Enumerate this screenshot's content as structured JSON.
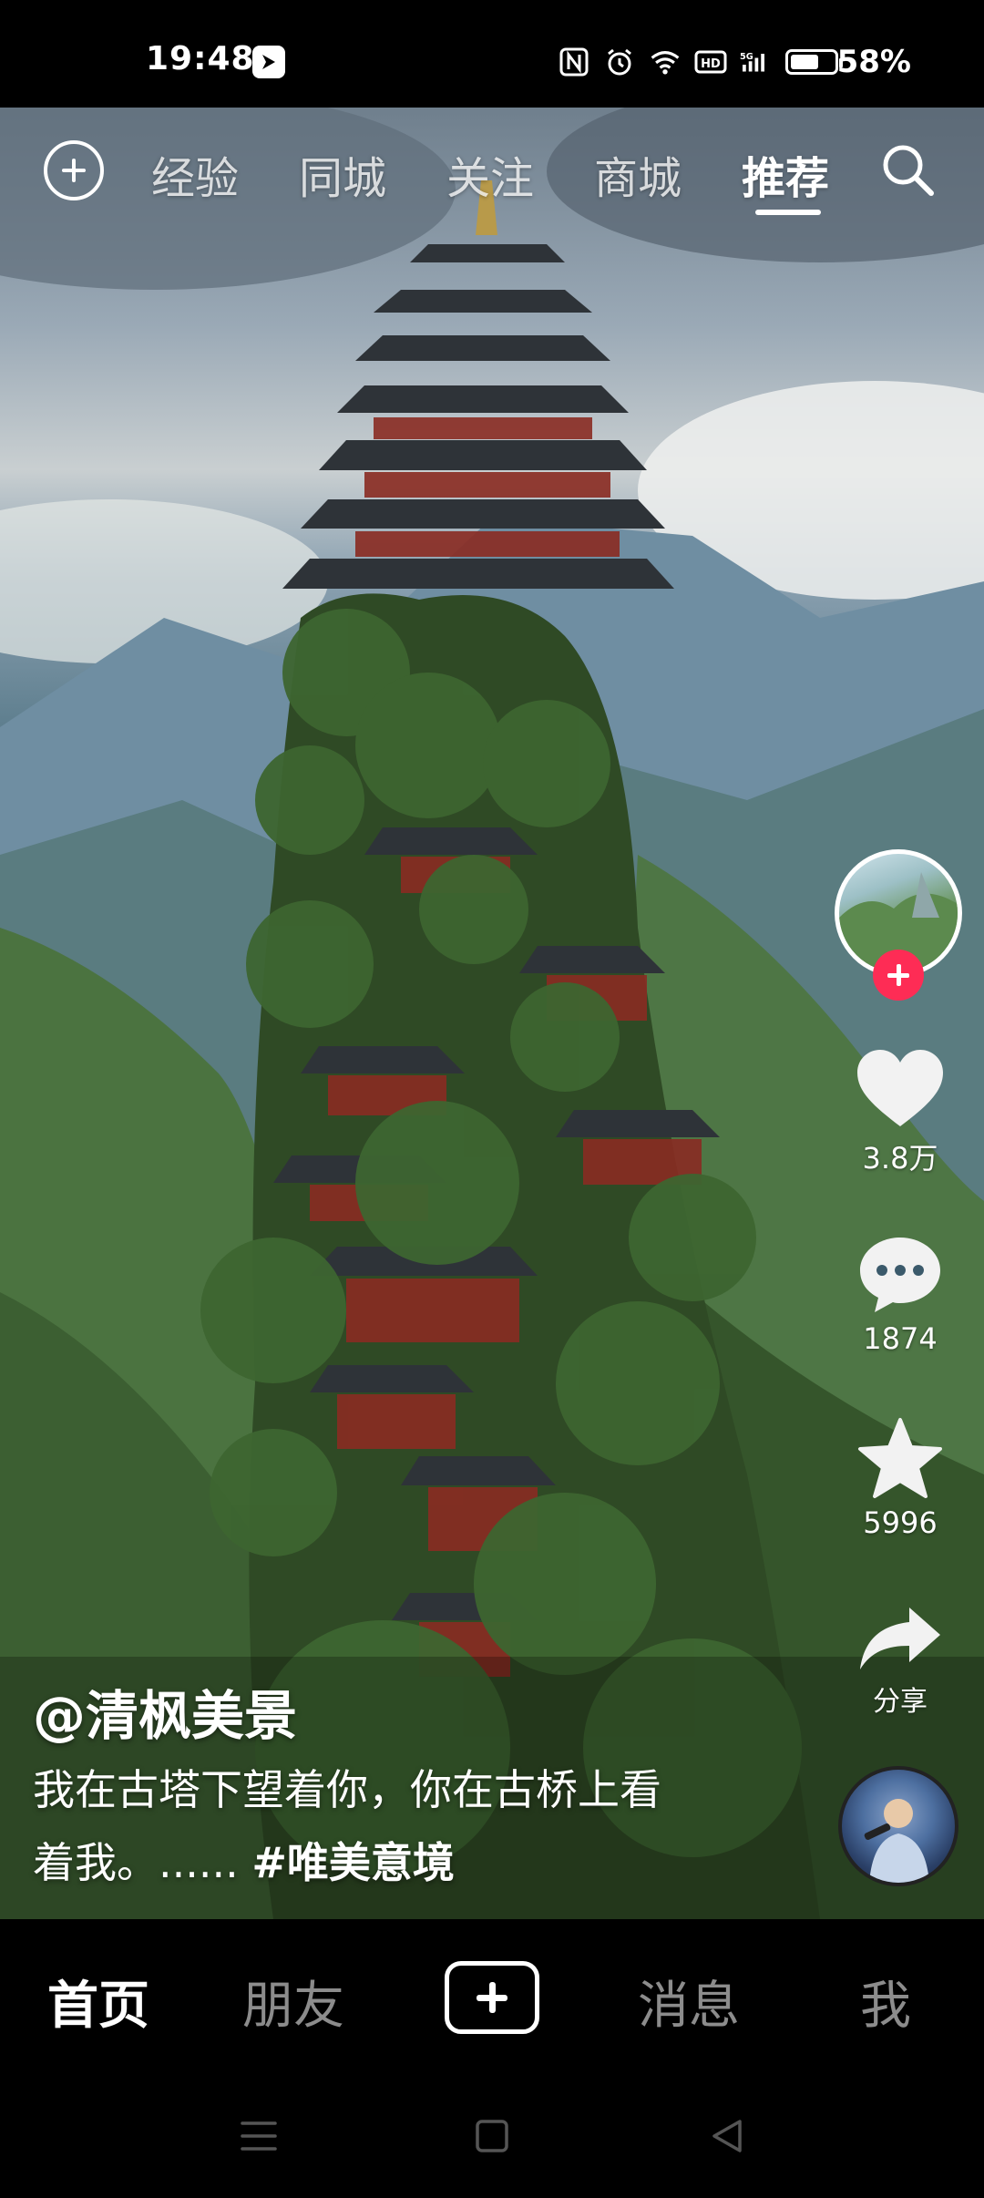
{
  "status_bar": {
    "time": "19:48",
    "battery_percent_text": "58%",
    "battery_level": 0.58,
    "icons": [
      "app-notification-icon",
      "nfc-icon",
      "alarm-icon",
      "wifi-icon",
      "hd-icon",
      "5g-signal-icon",
      "battery-icon"
    ]
  },
  "top_nav": {
    "tabs": [
      {
        "label": "经验"
      },
      {
        "label": "同城"
      },
      {
        "label": "关注"
      },
      {
        "label": "商城"
      },
      {
        "label": "推荐"
      }
    ],
    "active_tab": "推荐",
    "icons": [
      "add-icon",
      "search-icon"
    ]
  },
  "side_actions": {
    "likes": "3.8万",
    "comments": "1874",
    "favorites": "5996",
    "share_label": "分享"
  },
  "post": {
    "author": "@清枫美景",
    "caption_line1": "我在古塔下望着你，你在古桥上看",
    "caption_line2": "着我。......",
    "hashtag": "#唯美意境"
  },
  "bottom_nav": {
    "home": "首页",
    "friends": "朋友",
    "messages": "消息",
    "me": "我",
    "active": "首页"
  },
  "colors": {
    "follow_badge": "#fe2c55",
    "background": "#000000",
    "text": "#ffffff"
  }
}
